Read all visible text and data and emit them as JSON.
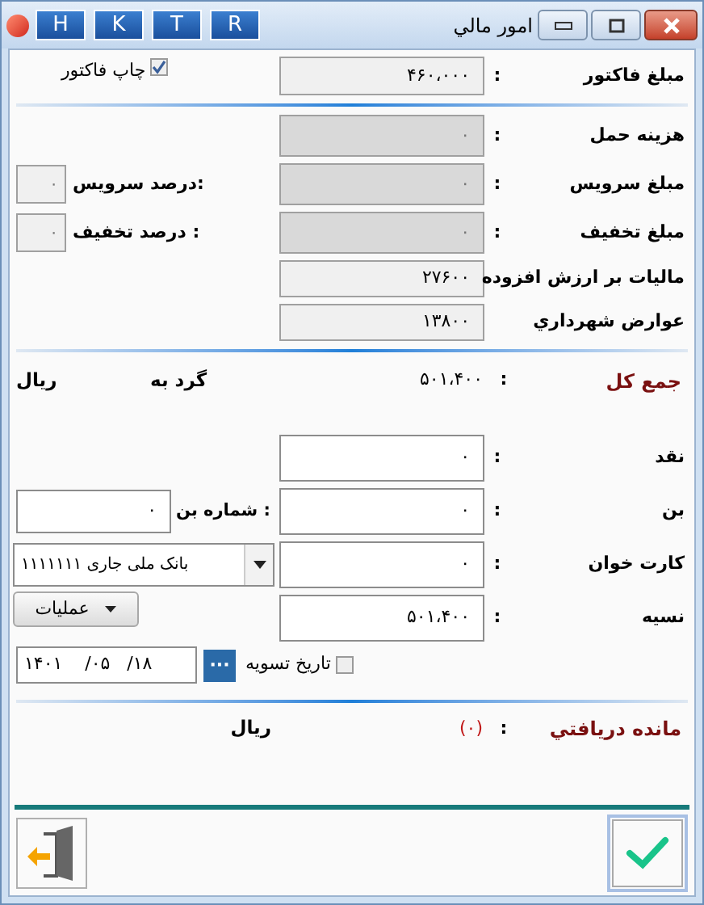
{
  "window": {
    "title": "امور مالي",
    "app_buttons": [
      "R",
      "T",
      "K",
      "H"
    ]
  },
  "sections": [
    [
      {
        "label": "مبلغ فاكتور",
        "colon": ":",
        "value": "۴۶۰،۰۰۰",
        "kind": "readonly",
        "side": {
          "kind": "checkbox",
          "label": "چاپ فاکتور",
          "checked": true
        }
      }
    ],
    [
      {
        "label": "هزينه حمل",
        "colon": ":",
        "value": "۰",
        "kind": "disabled"
      },
      {
        "label": "مبلغ سرويس",
        "colon": ":",
        "value": "۰",
        "kind": "disabled",
        "side": {
          "kind": "percent",
          "label": "درصد سرويس:",
          "value": "۰"
        }
      },
      {
        "label": "مبلغ تخفيف",
        "colon": ":",
        "value": "۰",
        "kind": "disabled",
        "side": {
          "kind": "percent",
          "label": "درصد تخفيف :",
          "value": "۰"
        }
      },
      {
        "label": "ماليات بر ارزش افزوده",
        "value": "۲۷۶۰۰",
        "kind": "readonly"
      },
      {
        "label": "عوارض شهرداري",
        "value": "۱۳۸۰۰",
        "kind": "readonly"
      }
    ]
  ],
  "total": {
    "label": "جمع كل",
    "colon": ":",
    "value": "۵۰۱،۴۰۰",
    "round_label": "گرد به",
    "currency": "ريال"
  },
  "payments": [
    {
      "label": "نقد",
      "colon": ":",
      "value": "۰",
      "kind": "editable"
    },
    {
      "label": "بن",
      "colon": ":",
      "value": "۰",
      "kind": "editable",
      "side": {
        "kind": "voucher",
        "label": "شماره بن :",
        "value": "۰"
      }
    },
    {
      "label": "كارت خوان",
      "colon": ":",
      "value": "۰",
      "kind": "editable",
      "side": {
        "kind": "select",
        "value": "بانک ملی جاری ۱۱۱۱۱۱۱"
      }
    },
    {
      "label": "نسيه",
      "colon": ":",
      "value": "۵۰۱،۴۰۰",
      "kind": "editable",
      "side": {
        "kind": "menu",
        "label": "عمليات"
      }
    }
  ],
  "settlement": {
    "date": "۱۴۰۱    /۰۵   /۱۸",
    "picker": "···",
    "label": "تاريخ تسويه",
    "checked": false
  },
  "balance": {
    "label": "مانده دريافتي",
    "colon": ":",
    "value": "(۰)",
    "currency": "ريال"
  }
}
